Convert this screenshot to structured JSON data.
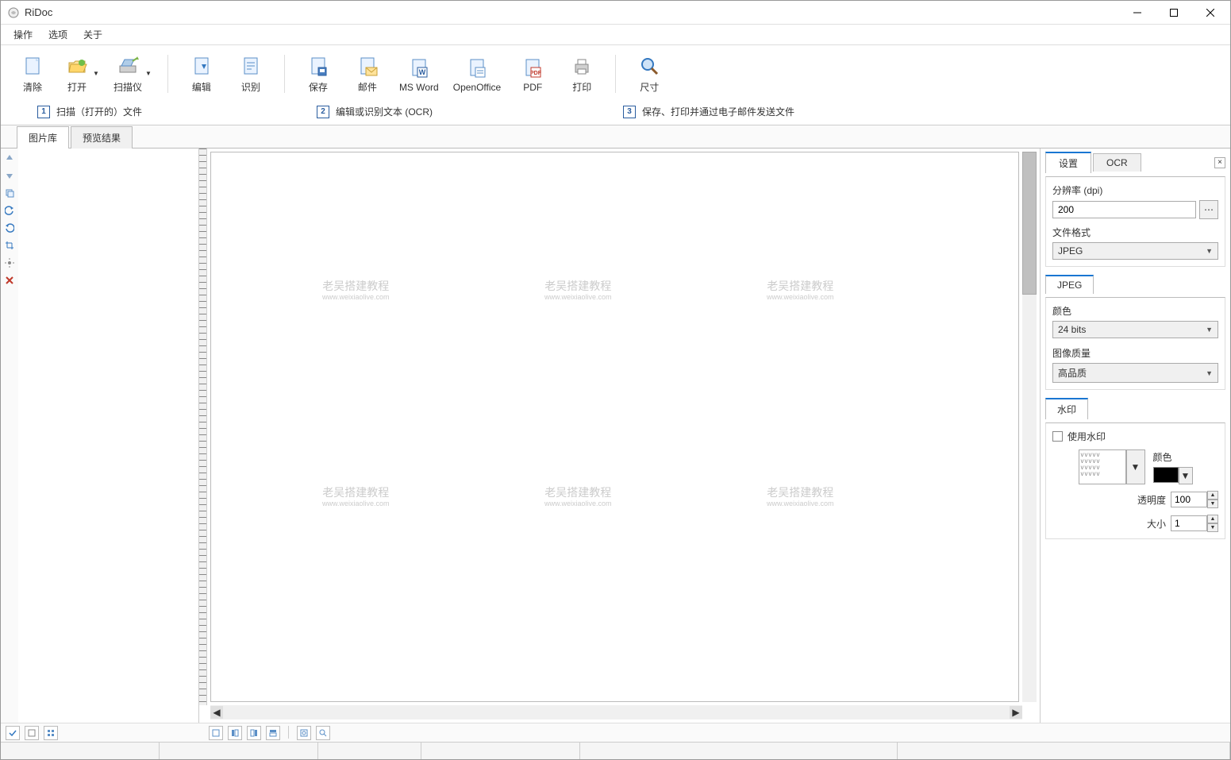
{
  "app": {
    "title": "RiDoc"
  },
  "menu": {
    "actions": "操作",
    "options": "选项",
    "about": "关于"
  },
  "toolbar": {
    "clear": "清除",
    "open": "打开",
    "scanner": "扫描仪",
    "edit": "编辑",
    "recognize": "识别",
    "save": "保存",
    "mail": "邮件",
    "msword": "MS Word",
    "openoffice": "OpenOffice",
    "pdf": "PDF",
    "print": "打印",
    "size": "尺寸"
  },
  "info": {
    "n1": "1",
    "t1": "扫描（打开的）文件",
    "n2": "2",
    "t2": "编辑或识别文本 (OCR)",
    "n3": "3",
    "t3": "保存、打印并通过电子邮件发送文件"
  },
  "tabs": {
    "gallery": "图片库",
    "preview": "预览结果"
  },
  "right": {
    "tab_settings": "设置",
    "tab_ocr": "OCR",
    "resolution_label": "分辨率 (dpi)",
    "resolution_value": "200",
    "fileformat_label": "文件格式",
    "fileformat_value": "JPEG",
    "jpeg_tab": "JPEG",
    "color_label": "颜色",
    "color_value": "24 bits",
    "quality_label": "图像质量",
    "quality_value": "高品质",
    "watermark_tab": "水印",
    "use_watermark": "使用水印",
    "wm_color_label": "颜色",
    "opacity_label": "透明度",
    "opacity_value": "100",
    "size_label": "大小",
    "size_value": "1"
  },
  "watermark_text": {
    "main": "老吴搭建教程",
    "sub": "www.weixiaolive.com"
  }
}
